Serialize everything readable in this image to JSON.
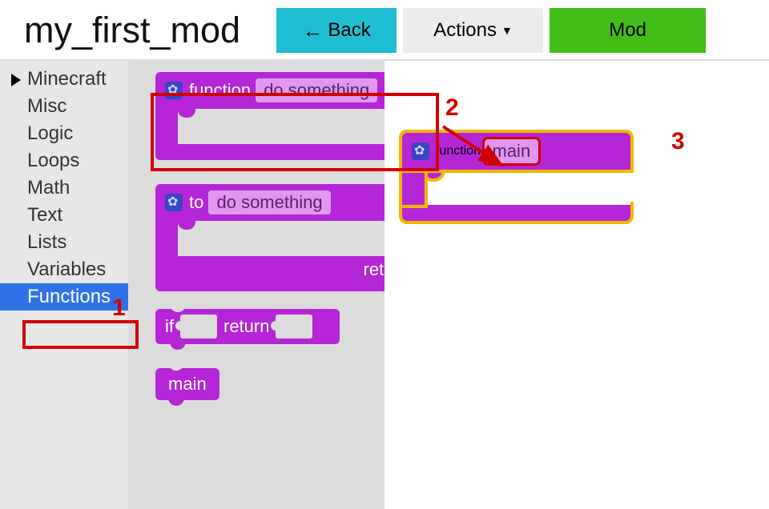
{
  "header": {
    "mod_title": "my_first_mod",
    "back_label": "Back",
    "actions_label": "Actions",
    "mod_label": "Mod"
  },
  "sidebar": {
    "items": [
      {
        "label": "Minecraft",
        "hasarrow": true
      },
      {
        "label": "Misc"
      },
      {
        "label": "Logic"
      },
      {
        "label": "Loops"
      },
      {
        "label": "Math"
      },
      {
        "label": "Text"
      },
      {
        "label": "Lists"
      },
      {
        "label": "Variables"
      },
      {
        "label": "Functions",
        "selected": true
      }
    ]
  },
  "toolbox": {
    "block1": {
      "keyword": "function",
      "name": "do something"
    },
    "block2": {
      "keyword": "to",
      "name": "do something",
      "return": "return"
    },
    "block3": {
      "if": "if",
      "return": "return"
    },
    "block4": {
      "label": "main"
    }
  },
  "canvas": {
    "block": {
      "keyword": "function",
      "name": "main"
    }
  },
  "annotations": {
    "1": "1",
    "2": "2",
    "3": "3"
  },
  "colors": {
    "block_purple": "#b526d6",
    "field_purple": "#e197f0",
    "gear_blue": "#3744c7",
    "back_btn": "#1fbdd2",
    "mod_btn": "#43bd17",
    "anno_red": "#d10000",
    "gold": "#f3b700"
  }
}
